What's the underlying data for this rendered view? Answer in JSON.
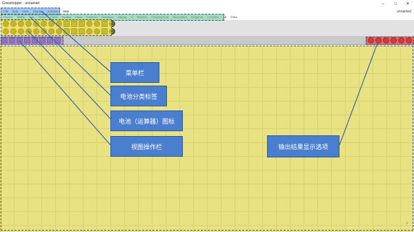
{
  "app": {
    "title": "Grasshopper - unnamed",
    "document": "unnamed",
    "controls": [
      "–",
      "□",
      "✕"
    ]
  },
  "menu": [
    "File",
    "Edit",
    "View",
    "Display",
    "Solution",
    "Help"
  ],
  "tabs": [
    "Params",
    "Maths",
    "Sets",
    "Vector",
    "Curve",
    "Surface",
    "Mesh",
    "Intersect",
    "Transform",
    "Display",
    "V",
    "BullAuto",
    "PanelingTools",
    "Weaverbird",
    "Kangaroo",
    "Lunchbox",
    "LB",
    "Extra"
  ],
  "callouts": {
    "menu_bar": "菜单栏",
    "component_tabs": "电池分类标签",
    "components": "电池（运算器）图标",
    "view_toolbar": "视图操作栏",
    "preview_options": "输出结果显示选项"
  },
  "colors": {
    "canvas": "#e8e282",
    "callout": "#4a7fd0",
    "menu_highlight": "#5a96dc",
    "tabs_highlight": "#6ec896",
    "components_highlight": "#f0dc28",
    "view_highlight": "#a06ed2",
    "preview_highlight": "#dc3232"
  },
  "canvas_zoom_icon": "zoom-icon"
}
